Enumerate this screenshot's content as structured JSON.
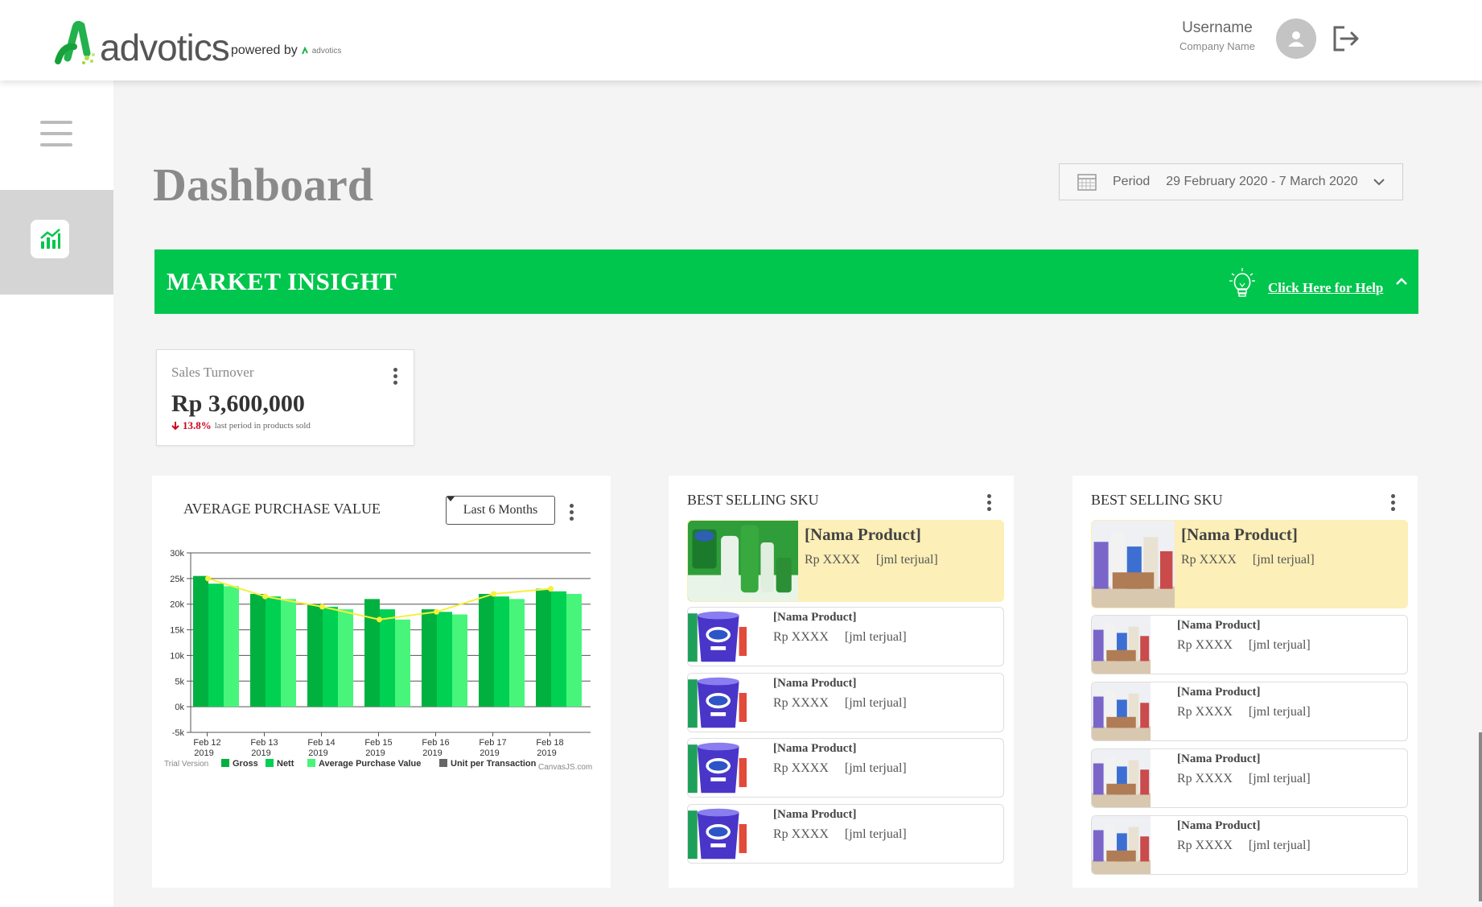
{
  "header": {
    "logo_text": "advotics",
    "powered_by": "powered by",
    "powered_brand": "advotics",
    "username": "Username",
    "company": "Company Name",
    "avatar_icon": "user-icon",
    "logout_icon": "logout-icon"
  },
  "sidebar": {
    "menu_icon": "hamburger-icon",
    "active_item_icon": "chart-icon"
  },
  "page": {
    "title": "Dashboard",
    "period_label": "Period",
    "period_value": "29 February 2020 - 7 March 2020"
  },
  "banner": {
    "title": "MARKET INSIGHT",
    "help_label": "Click Here for Help",
    "color": "#00c64d"
  },
  "kpi": {
    "label": "Sales Turnover",
    "value": "Rp 3,600,000",
    "change": "13.8%",
    "change_text": "last period in products sold"
  },
  "apv": {
    "title": "AVERAGE PURCHASE VALUE",
    "range": "Last 6 Months",
    "trial": "Trial Version",
    "credit": "CanvasJS.com"
  },
  "chart_data": {
    "type": "bar",
    "categories": [
      "Feb 12 2019",
      "Feb 13 2019",
      "Feb 14 2019",
      "Feb 15 2019",
      "Feb 16 2019",
      "Feb 17 2019",
      "Feb 18 2019"
    ],
    "tick_lines": [
      [
        "Feb 12",
        "2019"
      ],
      [
        "Feb 13",
        "2019"
      ],
      [
        "Feb 14",
        "2019"
      ],
      [
        "Feb 15",
        "2019"
      ],
      [
        "Feb 16",
        "2019"
      ],
      [
        "Feb 17",
        "2019"
      ],
      [
        "Feb 18",
        "2019"
      ]
    ],
    "yticks": [
      "-5k",
      "0k",
      "5k",
      "10k",
      "15k",
      "20k",
      "25k",
      "30k"
    ],
    "ylim": [
      -5000,
      30000
    ],
    "series": [
      {
        "name": "Gross",
        "type": "bar",
        "color": "#00b140",
        "values": [
          25500,
          22000,
          20000,
          21000,
          19000,
          22000,
          23000
        ]
      },
      {
        "name": "Nett",
        "type": "bar",
        "color": "#00d152",
        "values": [
          24000,
          21500,
          19500,
          19000,
          18500,
          21500,
          22500
        ]
      },
      {
        "name": "Average Purchase Value",
        "type": "bar",
        "color": "#47f57a",
        "values": [
          23500,
          21000,
          19000,
          17000,
          18000,
          21000,
          22000
        ]
      },
      {
        "name": "Unit per Transaction",
        "type": "line",
        "color": "#f7ef3a",
        "legend_color": "#666666",
        "values": [
          25000,
          21500,
          19500,
          17000,
          18500,
          22000,
          23000
        ]
      }
    ]
  },
  "sku_lists": [
    {
      "title": "BEST SELLING SKU",
      "thumb_style": "green",
      "top": {
        "name": "[Nama Product]",
        "price": "Rp XXXX",
        "sold": "[jml terjual]"
      },
      "items": [
        {
          "name": "[Nama Product]",
          "price": "Rp XXXX",
          "sold": "[jml terjual]"
        },
        {
          "name": "[Nama Product]",
          "price": "Rp XXXX",
          "sold": "[jml terjual]"
        },
        {
          "name": "[Nama Product]",
          "price": "Rp XXXX",
          "sold": "[jml terjual]"
        },
        {
          "name": "[Nama Product]",
          "price": "Rp XXXX",
          "sold": "[jml terjual]"
        }
      ]
    },
    {
      "title": "BEST SELLING SKU",
      "thumb_style": "mixed",
      "top": {
        "name": "[Nama Product]",
        "price": "Rp XXXX",
        "sold": "[jml terjual]"
      },
      "items": [
        {
          "name": "[Nama Product]",
          "price": "Rp XXXX",
          "sold": "[jml terjual]"
        },
        {
          "name": "[Nama Product]",
          "price": "Rp XXXX",
          "sold": "[jml terjual]"
        },
        {
          "name": "[Nama Product]",
          "price": "Rp XXXX",
          "sold": "[jml terjual]"
        },
        {
          "name": "[Nama Product]",
          "price": "Rp XXXX",
          "sold": "[jml terjual]"
        }
      ]
    }
  ]
}
